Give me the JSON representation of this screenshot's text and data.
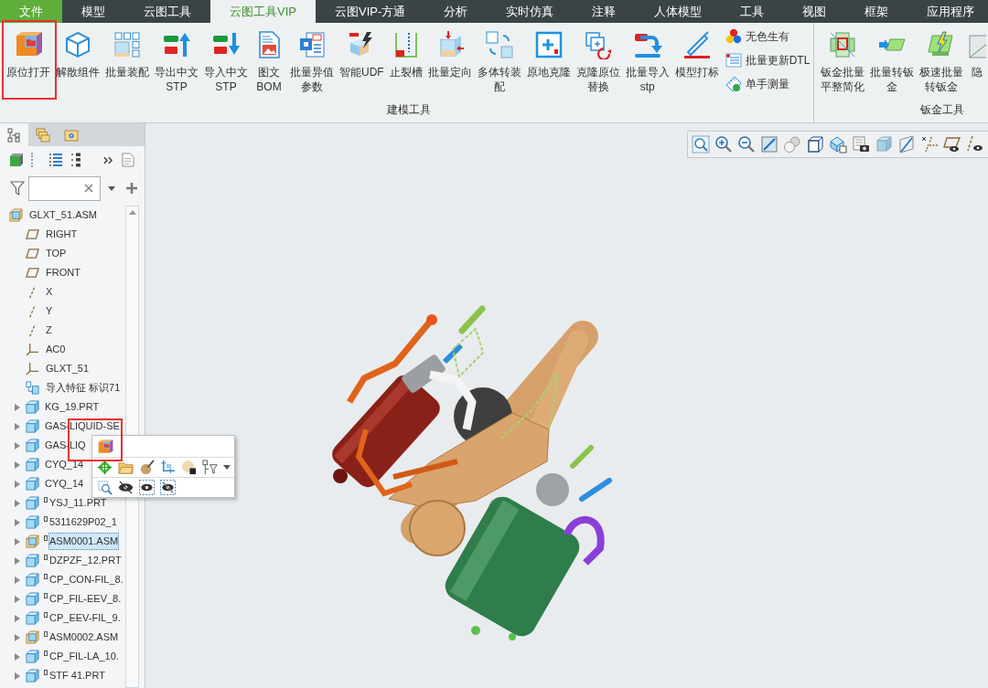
{
  "tabs": [
    {
      "label": "文件",
      "kind": "file",
      "selected": false
    },
    {
      "label": "模型",
      "kind": "tab",
      "selected": false
    },
    {
      "label": "云图工具",
      "kind": "tab",
      "selected": false
    },
    {
      "label": "云图工具VIP",
      "kind": "tab",
      "selected": true
    },
    {
      "label": "云图VIP-方通",
      "kind": "tab",
      "selected": false
    },
    {
      "label": "分析",
      "kind": "tab",
      "selected": false
    },
    {
      "label": "实时仿真",
      "kind": "tab",
      "selected": false
    },
    {
      "label": "注释",
      "kind": "tab",
      "selected": false
    },
    {
      "label": "人体模型",
      "kind": "tab",
      "selected": false
    },
    {
      "label": "工具",
      "kind": "tab",
      "selected": false
    },
    {
      "label": "视图",
      "kind": "tab",
      "selected": false
    },
    {
      "label": "框架",
      "kind": "tab",
      "selected": false
    },
    {
      "label": "应用程序",
      "kind": "tab",
      "selected": false
    }
  ],
  "ribbon": {
    "groups": [
      {
        "label": "建模工具",
        "buttons": [
          {
            "lines": [
              "原位打开"
            ],
            "kind": "large"
          },
          {
            "lines": [
              "解散组件"
            ],
            "kind": "large"
          },
          {
            "lines": [
              "批量装配"
            ],
            "kind": "large"
          },
          {
            "lines": [
              "导出中文",
              "STP"
            ],
            "kind": "large"
          },
          {
            "lines": [
              "导入中文",
              "STP"
            ],
            "kind": "large"
          },
          {
            "lines": [
              "图文",
              "BOM"
            ],
            "kind": "large"
          },
          {
            "lines": [
              "批量异值",
              "参数"
            ],
            "kind": "large"
          },
          {
            "lines": [
              "智能UDF"
            ],
            "kind": "large"
          },
          {
            "lines": [
              "止裂槽"
            ],
            "kind": "large"
          },
          {
            "lines": [
              "批量定向"
            ],
            "kind": "large"
          },
          {
            "lines": [
              "多体转装",
              "配"
            ],
            "kind": "large"
          },
          {
            "lines": [
              "原地克隆"
            ],
            "kind": "large"
          },
          {
            "lines": [
              "克隆原位",
              "替换"
            ],
            "kind": "large"
          },
          {
            "lines": [
              "批量导入",
              "stp"
            ],
            "kind": "large"
          },
          {
            "lines": [
              "模型打标"
            ],
            "kind": "large"
          },
          {
            "lines": [
              "无色生有"
            ],
            "kind": "small"
          },
          {
            "lines": [
              "批量更新DTL"
            ],
            "kind": "small"
          },
          {
            "lines": [
              "单手测量"
            ],
            "kind": "small"
          }
        ]
      },
      {
        "label": "钣金工具",
        "buttons": [
          {
            "lines": [
              "钣金批量",
              "平整简化"
            ],
            "kind": "large"
          },
          {
            "lines": [
              "批量转钣",
              "金"
            ],
            "kind": "large"
          },
          {
            "lines": [
              "极速批量",
              "转钣金"
            ],
            "kind": "large"
          },
          {
            "lines": [
              "隐"
            ],
            "kind": "large"
          }
        ]
      }
    ]
  },
  "panel_tabs": [
    {
      "selected": true
    },
    {
      "selected": false
    },
    {
      "selected": false
    }
  ],
  "model_tree": {
    "root": {
      "label": "GLXT_51.ASM",
      "kind": "assembly",
      "selected": false
    },
    "features": [
      {
        "label": "RIGHT",
        "kind": "plane",
        "selected": false
      },
      {
        "label": "TOP",
        "kind": "plane",
        "selected": false
      },
      {
        "label": "FRONT",
        "kind": "plane",
        "selected": false
      },
      {
        "label": "X",
        "kind": "axis",
        "selected": false
      },
      {
        "label": "Y",
        "kind": "axis",
        "selected": false
      },
      {
        "label": "Z",
        "kind": "axis",
        "selected": false
      },
      {
        "label": "AC0",
        "kind": "csys",
        "selected": false
      },
      {
        "label": "GLXT_51",
        "kind": "csys",
        "selected": false
      },
      {
        "label": "导入特征 标识71",
        "kind": "import",
        "selected": false
      }
    ],
    "components": [
      {
        "label": "KG_19.PRT",
        "kind": "part",
        "flagged": false,
        "expanded": false,
        "selected": false
      },
      {
        "label": "GAS-LIQUID-SE",
        "kind": "part",
        "flagged": false,
        "expanded": false,
        "selected": false
      },
      {
        "label": "GAS-LIQ",
        "kind": "part",
        "flagged": false,
        "expanded": false,
        "selected": false
      },
      {
        "label": "CYQ_14",
        "kind": "part",
        "flagged": false,
        "expanded": false,
        "selected": false
      },
      {
        "label": "CYQ_14",
        "kind": "part",
        "flagged": false,
        "expanded": false,
        "selected": false
      },
      {
        "label": "YSJ_11.PRT",
        "kind": "part",
        "flagged": true,
        "expanded": false,
        "selected": false
      },
      {
        "label": "5311629P02_1",
        "kind": "part",
        "flagged": true,
        "expanded": false,
        "selected": false
      },
      {
        "label": "ASM0001.ASM",
        "kind": "assembly",
        "flagged": true,
        "expanded": false,
        "selected": true
      },
      {
        "label": "DZPZF_12.PRT",
        "kind": "part",
        "flagged": true,
        "expanded": false,
        "selected": false
      },
      {
        "label": "CP_CON-FIL_8.",
        "kind": "part",
        "flagged": true,
        "expanded": false,
        "selected": false
      },
      {
        "label": "CP_FIL-EEV_8.",
        "kind": "part",
        "flagged": true,
        "expanded": false,
        "selected": false
      },
      {
        "label": "CP_EEV-FIL_9.",
        "kind": "part",
        "flagged": true,
        "expanded": false,
        "selected": false
      },
      {
        "label": "ASM0002.ASM",
        "kind": "assembly",
        "flagged": true,
        "expanded": false,
        "selected": false
      },
      {
        "label": "CP_FIL-LA_10.",
        "kind": "part",
        "flagged": true,
        "expanded": false,
        "selected": false
      },
      {
        "label": "STF 41.PRT",
        "kind": "part",
        "flagged": true,
        "expanded": false,
        "selected": false
      }
    ]
  }
}
